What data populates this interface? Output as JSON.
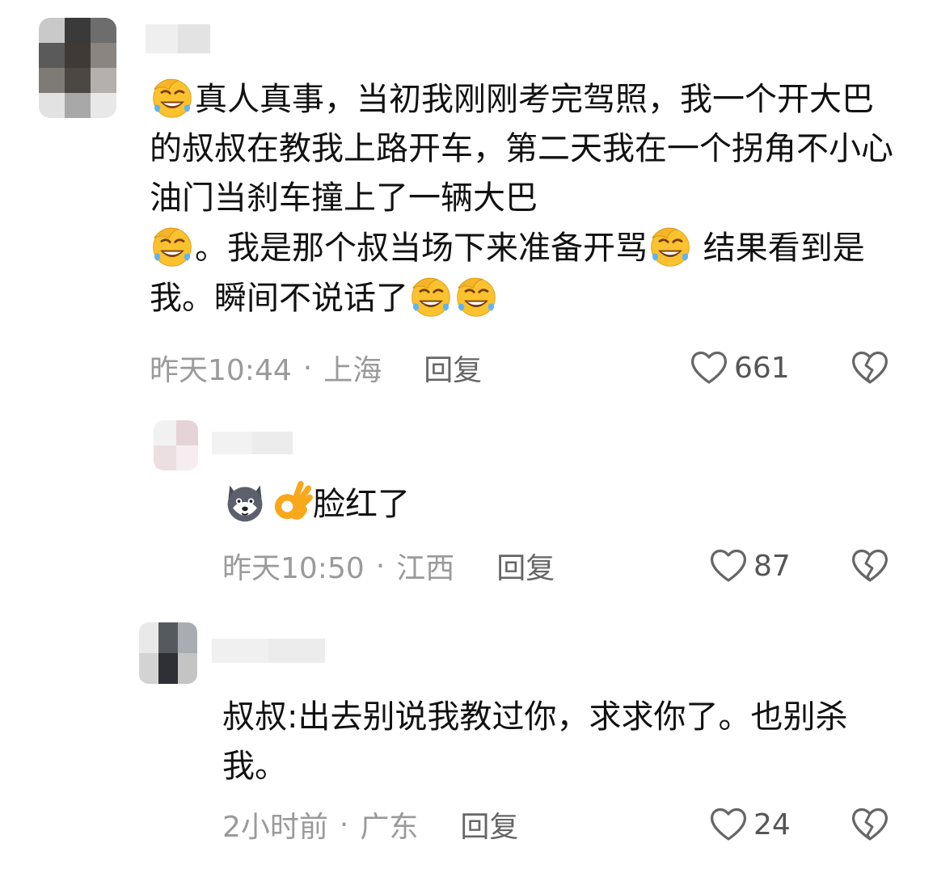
{
  "comments": [
    {
      "text_1": "真人真事，当初我刚刚考完驾照，我一个开大巴的叔叔在教我上路开车，第二天我在一个拐角不小心油门当刹车撞上了一辆大巴",
      "text_2": "。我是那个叔当场下来准备开骂",
      "text_3": " 结果看到是我。瞬间不说话了",
      "emojis": [
        "facepalm-laugh-emoji",
        "facepalm-laugh-emoji",
        "facepalm-laugh-emoji",
        "facepalm-laugh-emoji",
        "facepalm-laugh-emoji"
      ],
      "time": "昨天10:44",
      "dot": "·",
      "location": "上海",
      "reply": "回复",
      "likes": "661"
    },
    {
      "text": "脸红了",
      "emojis": [
        "husky-dog-emoji",
        "ok-hand-emoji"
      ],
      "time": "昨天10:50",
      "dot": "·",
      "location": "江西",
      "reply": "回复",
      "likes": "87"
    },
    {
      "text": "叔叔:出去别说我教过你，求求你了。也别杀我。",
      "time": "2小时前",
      "dot": "·",
      "location": "广东",
      "reply": "回复",
      "likes": "24"
    }
  ],
  "icons": {
    "like": "heart-outline-icon",
    "dislike": "broken-heart-icon"
  },
  "colors": {
    "meta_text": "#9a9a9a",
    "reply_text": "#666666",
    "body_text": "#111111",
    "emoji_yellow": "#f7b731"
  }
}
